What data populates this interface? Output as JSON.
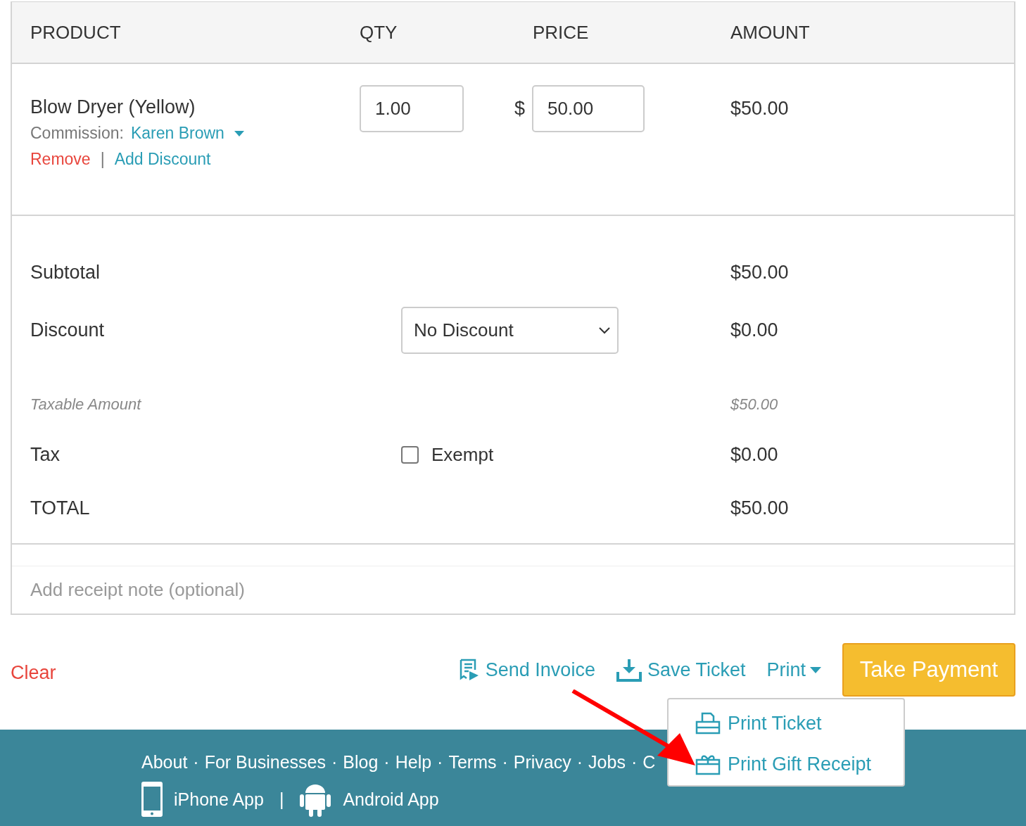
{
  "table": {
    "columns": [
      "PRODUCT",
      "QTY",
      "PRICE",
      "AMOUNT"
    ],
    "rows": [
      {
        "name": "Blow Dryer (Yellow)",
        "commission_label": "Commission:",
        "commission": "Karen Brown",
        "remove": "Remove",
        "separator": "|",
        "add_discount": "Add Discount",
        "qty": "1.00",
        "currency": "$",
        "price": "50.00",
        "amount": "$50.00"
      }
    ]
  },
  "totals": [
    {
      "kind": "plain",
      "label": "Subtotal",
      "amount": "$50.00"
    },
    {
      "kind": "select",
      "label": "Discount",
      "value": "No Discount",
      "amount": "$0.00"
    },
    {
      "kind": "muted",
      "label": "Taxable Amount",
      "amount": "$50.00"
    },
    {
      "kind": "checkbox",
      "label": "Tax",
      "option": "Exempt",
      "checked": false,
      "amount": "$0.00"
    },
    {
      "kind": "total",
      "label": "TOTAL",
      "amount": "$50.00"
    }
  ],
  "note": {
    "placeholder": "Add receipt note (optional)"
  },
  "actions": {
    "clear": "Clear",
    "send_invoice": "Send Invoice",
    "save_ticket": "Save Ticket",
    "print": "Print",
    "take_payment": "Take Payment"
  },
  "print_menu": {
    "expanded": true,
    "items": [
      {
        "kind": "ticket",
        "label": "Print Ticket"
      },
      {
        "kind": "gift",
        "label": "Print Gift Receipt"
      }
    ]
  },
  "footer": {
    "links": [
      "About",
      "For Businesses",
      "Blog",
      "Help",
      "Terms",
      "Privacy",
      "Jobs",
      "C"
    ],
    "separator": "·",
    "apps": [
      {
        "kind": "iphone",
        "label": "iPhone App"
      },
      {
        "kind": "android",
        "label": "Android App"
      }
    ],
    "app_separator": "|"
  }
}
